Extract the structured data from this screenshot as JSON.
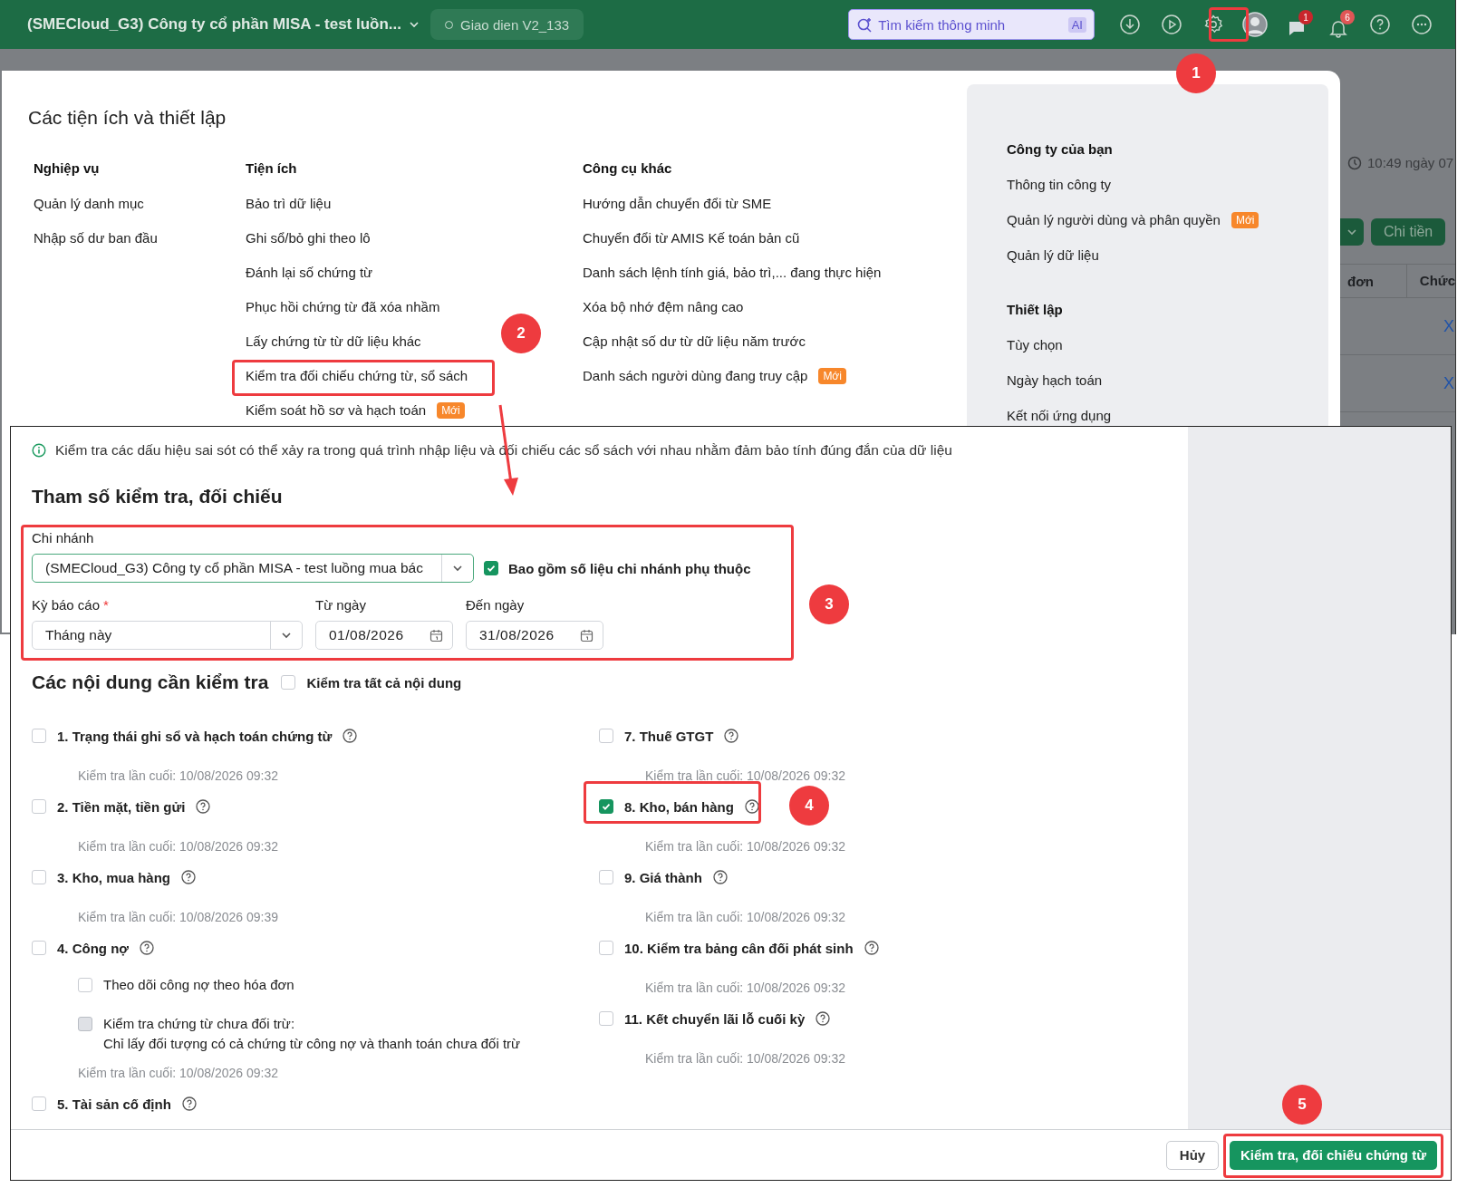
{
  "app_header": {
    "company": "(SMECloud_G3) Công ty cổ phần MISA - test luồn...",
    "version_badge": "Giao dien V2_133",
    "search": {
      "placeholder": "Tìm kiếm thông minh",
      "ai_badge": "AI"
    },
    "chat_count": "1",
    "notification_count": "6"
  },
  "background_page": {
    "timestamp": "10:49 ngày 07",
    "button": "Chi tiền",
    "columns": [
      "đơn",
      "Chức"
    ],
    "row_links": [
      "X",
      "X"
    ]
  },
  "settings_popup": {
    "title": "Các tiện ích và thiết lập",
    "columns": [
      {
        "heading": "Nghiệp vụ",
        "items": [
          {
            "label": "Quản lý danh mục"
          },
          {
            "label": "Nhập số dư ban đầu"
          }
        ]
      },
      {
        "heading": "Tiện ích",
        "items": [
          {
            "label": "Bảo trì dữ liệu"
          },
          {
            "label": "Ghi sổ/bỏ ghi theo lô"
          },
          {
            "label": "Đánh lại số chứng từ"
          },
          {
            "label": "Phục hồi chứng từ đã xóa nhầm"
          },
          {
            "label": "Lấy chứng từ từ dữ liệu khác"
          },
          {
            "label": "Kiểm tra đối chiếu chứng từ, sổ sách"
          },
          {
            "label": "Kiểm soát hồ sơ và hạch toán",
            "badge": "Mới"
          }
        ]
      },
      {
        "heading": "Công cụ khác",
        "items": [
          {
            "label": "Hướng dẫn chuyển đổi từ SME"
          },
          {
            "label": "Chuyển đổi từ AMIS Kế toán bản cũ"
          },
          {
            "label": "Danh sách lệnh tính giá, bảo trì,... đang thực hiện"
          },
          {
            "label": "Xóa bộ nhớ đệm nâng cao"
          },
          {
            "label": "Cập nhật số dư từ dữ liệu năm trước"
          },
          {
            "label": "Danh sách người dùng đang truy cập",
            "badge": "Mới"
          }
        ]
      }
    ],
    "side_sections": [
      {
        "heading": "Công ty của bạn",
        "items": [
          {
            "label": "Thông tin công ty"
          },
          {
            "label": "Quản lý người dùng và phân quyền",
            "badge": "Mới"
          },
          {
            "label": "Quản lý dữ liệu"
          }
        ]
      },
      {
        "heading": "Thiết lập",
        "items": [
          {
            "label": "Tùy chọn"
          },
          {
            "label": "Ngày hạch toán"
          },
          {
            "label": "Kết nối ứng dụng"
          }
        ]
      }
    ]
  },
  "check_dialog": {
    "info": "Kiểm tra các dấu hiệu sai sót có thể xảy ra trong quá trình nhập liệu và đối chiếu các sổ sách với nhau nhằm đảm bảo tính đúng đắn của dữ liệu",
    "params_title": "Tham số kiểm tra, đối chiếu",
    "branch": {
      "label": "Chi nhánh",
      "value": "(SMECloud_G3) Công ty cổ phần MISA - test luồng mua bác"
    },
    "include_dependent": {
      "label": "Bao gồm số liệu chi nhánh phụ thuộc",
      "checked": true
    },
    "period": {
      "label": "Kỳ báo cáo",
      "required_mark": "*",
      "value": "Tháng này"
    },
    "from_date": {
      "label": "Từ ngày",
      "value": "01/08/2026"
    },
    "to_date": {
      "label": "Đến ngày",
      "value": "31/08/2026"
    },
    "contents_title": "Các nội dung cần kiểm tra",
    "check_all": {
      "label": "Kiểm tra tất cả nội dung",
      "checked": false
    },
    "items_left": [
      {
        "label": "1. Trạng thái ghi sổ và hạch toán chứng từ",
        "checked": false,
        "last_check": "Kiểm tra lần cuối: 10/08/2026 09:32"
      },
      {
        "label": "2. Tiền mặt, tiền gửi",
        "checked": false,
        "last_check": "Kiểm tra lần cuối: 10/08/2026 09:32"
      },
      {
        "label": "3. Kho, mua hàng",
        "checked": false,
        "last_check": "Kiểm tra lần cuối: 10/08/2026 09:39"
      },
      {
        "label": "4. Công nợ",
        "checked": false,
        "sub_options": [
          {
            "label": "Theo dõi công nợ theo hóa đơn",
            "checked": false,
            "disabled": false
          },
          {
            "label": "Kiểm tra chứng từ chưa đối trừ:\nChỉ lấy đối tượng có cả chứng từ công nợ và thanh toán chưa đối trừ",
            "checked": false,
            "disabled": true
          }
        ],
        "last_check": "Kiểm tra lần cuối: 10/08/2026 09:32"
      },
      {
        "label": "5. Tài sản cố định",
        "checked": false
      }
    ],
    "items_right": [
      {
        "label": "7. Thuế GTGT",
        "checked": false,
        "last_check": "Kiểm tra lần cuối: 10/08/2026 09:32"
      },
      {
        "label": "8. Kho, bán hàng",
        "checked": true,
        "last_check": "Kiểm tra lần cuối: 10/08/2026 09:32"
      },
      {
        "label": "9. Giá thành",
        "checked": false,
        "last_check": "Kiểm tra lần cuối: 10/08/2026 09:32"
      },
      {
        "label": "10. Kiểm tra bảng cân đối phát sinh",
        "checked": false,
        "last_check": "Kiểm tra lần cuối: 10/08/2026 09:32"
      },
      {
        "label": "11. Kết chuyển lãi lỗ cuối kỳ",
        "checked": false,
        "last_check": "Kiểm tra lần cuối: 10/08/2026 09:32"
      }
    ],
    "buttons": {
      "cancel": "Hủy",
      "submit": "Kiểm tra, đối chiếu chứng từ"
    }
  },
  "annotations": [
    {
      "number": "1"
    },
    {
      "number": "2"
    },
    {
      "number": "3"
    },
    {
      "number": "4"
    },
    {
      "number": "5"
    }
  ]
}
